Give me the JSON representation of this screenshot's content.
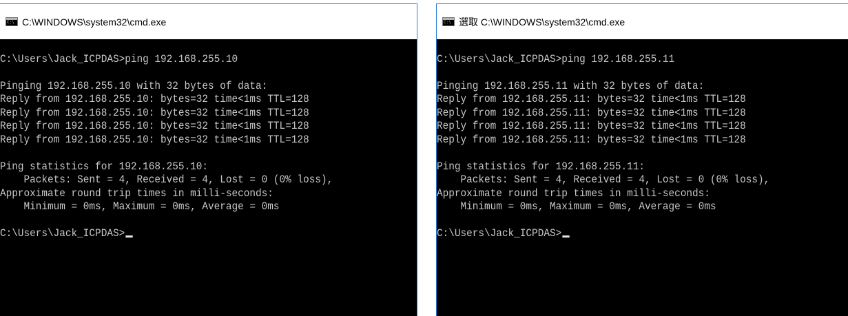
{
  "windows": [
    {
      "title": "C:\\WINDOWS\\system32\\cmd.exe",
      "lines": [
        "",
        "C:\\Users\\Jack_ICPDAS>ping 192.168.255.10",
        "",
        "Pinging 192.168.255.10 with 32 bytes of data:",
        "Reply from 192.168.255.10: bytes=32 time<1ms TTL=128",
        "Reply from 192.168.255.10: bytes=32 time<1ms TTL=128",
        "Reply from 192.168.255.10: bytes=32 time<1ms TTL=128",
        "Reply from 192.168.255.10: bytes=32 time<1ms TTL=128",
        "",
        "Ping statistics for 192.168.255.10:",
        "    Packets: Sent = 4, Received = 4, Lost = 0 (0% loss),",
        "Approximate round trip times in milli-seconds:",
        "    Minimum = 0ms, Maximum = 0ms, Average = 0ms",
        "",
        "C:\\Users\\Jack_ICPDAS>"
      ]
    },
    {
      "title": "選取 C:\\WINDOWS\\system32\\cmd.exe",
      "lines": [
        "",
        "C:\\Users\\Jack_ICPDAS>ping 192.168.255.11",
        "",
        "Pinging 192.168.255.11 with 32 bytes of data:",
        "Reply from 192.168.255.11: bytes=32 time<1ms TTL=128",
        "Reply from 192.168.255.11: bytes=32 time<1ms TTL=128",
        "Reply from 192.168.255.11: bytes=32 time<1ms TTL=128",
        "Reply from 192.168.255.11: bytes=32 time<1ms TTL=128",
        "",
        "Ping statistics for 192.168.255.11:",
        "    Packets: Sent = 4, Received = 4, Lost = 0 (0% loss),",
        "Approximate round trip times in milli-seconds:",
        "    Minimum = 0ms, Maximum = 0ms, Average = 0ms",
        "",
        "C:\\Users\\Jack_ICPDAS>"
      ]
    }
  ],
  "icons": {
    "app_icon": "cmd-console-icon"
  },
  "colors": {
    "console_background": "#000000",
    "console_text": "#c8c8c8",
    "titlebar_background": "#ffffff",
    "window_border": "#2b79d7"
  }
}
